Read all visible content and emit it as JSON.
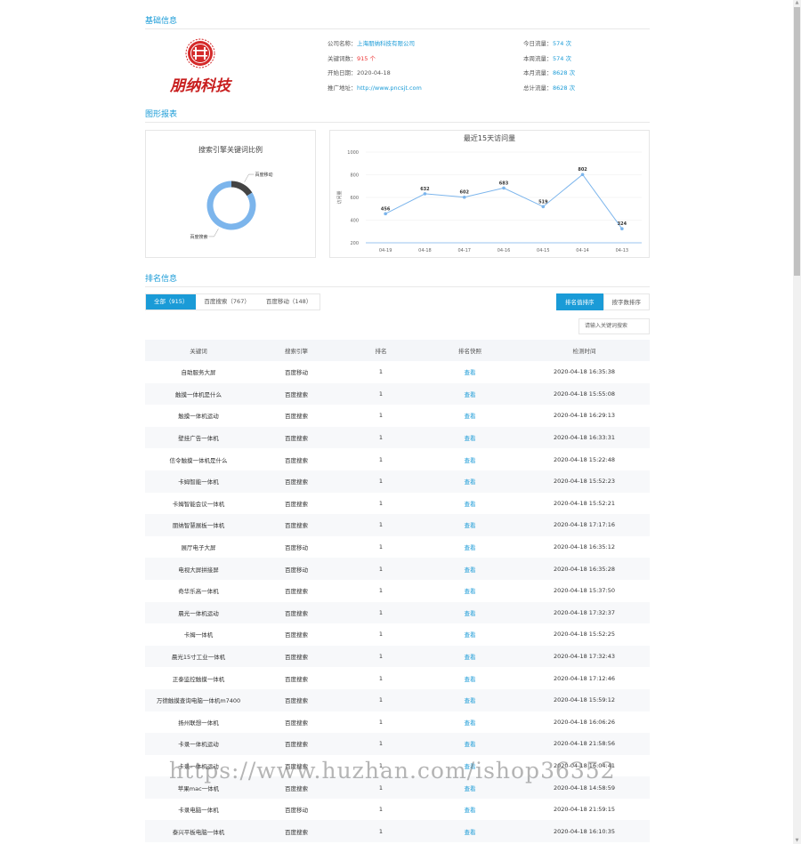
{
  "basic": {
    "title": "基础信息",
    "logo_text": "朋纳科技",
    "left": [
      {
        "label": "公司名称：",
        "value": "上海朋纳科技有限公司",
        "style": "link"
      },
      {
        "label": "关键词数：",
        "value": "915 个",
        "style": "red"
      },
      {
        "label": "开始日期：",
        "value": "2020-04-18",
        "style": "plain"
      },
      {
        "label": "推广地址：",
        "value": "http://www.pncsjt.com",
        "style": "link"
      }
    ],
    "right": [
      {
        "label": "今日流量：",
        "value": "574 次"
      },
      {
        "label": "本周流量：",
        "value": "574 次"
      },
      {
        "label": "本月流量：",
        "value": "8628 次"
      },
      {
        "label": "总计流量：",
        "value": "8628 次"
      }
    ]
  },
  "charts": {
    "title": "图形报表",
    "donut_title": "搜索引擎关键词比例",
    "line_title": "最近15天访问量"
  },
  "chart_data": [
    {
      "type": "pie",
      "title": "搜索引擎关键词比例",
      "categories": [
        "百度移动",
        "百度搜索"
      ],
      "values": [
        148,
        767
      ],
      "colors": [
        "#444444",
        "#7cb5ec"
      ]
    },
    {
      "type": "line",
      "title": "最近15天访问量",
      "ylabel": "访问量",
      "x": [
        "04-19",
        "04-18",
        "04-17",
        "04-16",
        "04-15",
        "04-14",
        "04-13"
      ],
      "values": [
        456,
        632,
        602,
        683,
        519,
        802,
        324
      ],
      "ylim": [
        200,
        1000
      ],
      "yticks": [
        200,
        400,
        600,
        800,
        1000
      ],
      "color": "#7cb5ec"
    }
  ],
  "ranking": {
    "title": "排名信息",
    "tabs": [
      "全部（915）",
      "百度搜索（767）",
      "百度移动（148）"
    ],
    "sort_buttons": [
      "排名值排序",
      "按字数排序"
    ],
    "search_placeholder": "请输入关键词搜索",
    "headers": [
      "关键词",
      "搜索引擎",
      "排名",
      "排名快照",
      "检测时间"
    ],
    "rows": [
      [
        "自助服务大屏",
        "百度移动",
        "1",
        "查看",
        "2020-04-18 16:35:38"
      ],
      [
        "触摸一体机是什么",
        "百度搜索",
        "1",
        "查看",
        "2020-04-18 15:55:08"
      ],
      [
        "触摸一体机运动",
        "百度搜索",
        "1",
        "查看",
        "2020-04-18 16:29:13"
      ],
      [
        "壁挂广告一体机",
        "百度搜索",
        "1",
        "查看",
        "2020-04-18 16:33:31"
      ],
      [
        "信令触摸一体机是什么",
        "百度搜索",
        "1",
        "查看",
        "2020-04-18 15:22:48"
      ],
      [
        "卡姆智能一体机",
        "百度搜索",
        "1",
        "查看",
        "2020-04-18 15:52:23"
      ],
      [
        "卡姆智能会议一体机",
        "百度搜索",
        "1",
        "查看",
        "2020-04-18 15:52:21"
      ],
      [
        "朋纳智慧展板一体机",
        "百度搜索",
        "1",
        "查看",
        "2020-04-18 17:17:16"
      ],
      [
        "展厅电子大屏",
        "百度移动",
        "1",
        "查看",
        "2020-04-18 16:35:12"
      ],
      [
        "电视大屏拼接屏",
        "百度移动",
        "1",
        "查看",
        "2020-04-18 16:35:28"
      ],
      [
        "奇华乐高一体机",
        "百度搜索",
        "1",
        "查看",
        "2020-04-18 15:37:50"
      ],
      [
        "晨光一体机运动",
        "百度搜索",
        "1",
        "查看",
        "2020-04-18 17:32:37"
      ],
      [
        "卡姆一体机",
        "百度搜索",
        "1",
        "查看",
        "2020-04-18 15:52:25"
      ],
      [
        "晨光15寸工业一体机",
        "百度搜索",
        "1",
        "查看",
        "2020-04-18 17:32:43"
      ],
      [
        "正泰监控触摸一体机",
        "百度搜索",
        "1",
        "查看",
        "2020-04-18 17:12:46"
      ],
      [
        "万德触摸查询电脑一体机m7400",
        "百度搜索",
        "1",
        "查看",
        "2020-04-18 15:59:12"
      ],
      [
        "扬州联想一体机",
        "百度搜索",
        "1",
        "查看",
        "2020-04-18 16:06:26"
      ],
      [
        "卡录一体机运动",
        "百度搜索",
        "1",
        "查看",
        "2020-04-18 21:58:56"
      ],
      [
        "卡录一体机运动",
        "百度搜索",
        "1",
        "查看",
        "2020-04-18 16:04:41"
      ],
      [
        "苹果mac一体机",
        "百度搜索",
        "1",
        "查看",
        "2020-04-18 14:58:59"
      ],
      [
        "卡录电脑一体机",
        "百度移动",
        "1",
        "查看",
        "2020-04-18 21:59:15"
      ],
      [
        "泰兴平板电脑一体机",
        "百度搜索",
        "1",
        "查看",
        "2020-04-18 16:10:35"
      ]
    ]
  },
  "watermark": "https://www.huzhan.com/ishop36352"
}
